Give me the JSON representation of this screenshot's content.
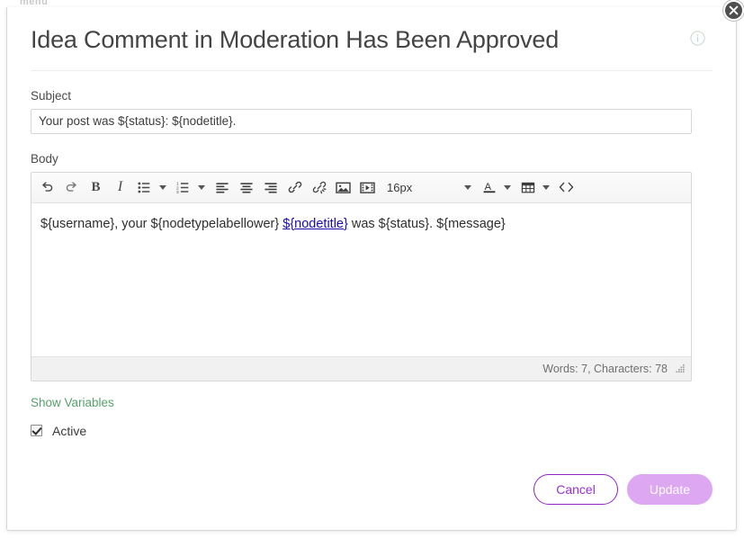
{
  "page_ghost": "menu",
  "dialog": {
    "title": "Idea Comment in Moderation Has Been Approved",
    "info_icon": "info-circle-icon",
    "close_icon": "close-icon"
  },
  "subject": {
    "label": "Subject",
    "value": "Your post was ${status}: ${nodetitle}.",
    "placeholder": ""
  },
  "body": {
    "label": "Body",
    "toolbar": {
      "items": [
        {
          "name": "undo-icon",
          "glyph": "undo",
          "label": ""
        },
        {
          "name": "redo-icon",
          "glyph": "redo",
          "label": ""
        },
        {
          "name": "bold-button",
          "glyph": "text",
          "label": "B"
        },
        {
          "name": "italic-button",
          "glyph": "text",
          "label": "I"
        },
        {
          "name": "unordered-list-icon",
          "glyph": "ul",
          "label": ""
        },
        {
          "name": "ordered-list-icon",
          "glyph": "ol",
          "label": ""
        },
        {
          "name": "align-left-icon",
          "glyph": "align-left",
          "label": ""
        },
        {
          "name": "align-center-icon",
          "glyph": "align-center",
          "label": ""
        },
        {
          "name": "align-right-icon",
          "glyph": "align-right",
          "label": ""
        },
        {
          "name": "link-icon",
          "glyph": "link",
          "label": ""
        },
        {
          "name": "unlink-icon",
          "glyph": "unlink",
          "label": ""
        },
        {
          "name": "image-icon",
          "glyph": "image",
          "label": ""
        },
        {
          "name": "video-icon",
          "glyph": "video",
          "label": ""
        }
      ],
      "font_size": "16px",
      "text_color_icon": "font-color-icon",
      "table_icon": "table-icon",
      "source_code_icon": "source-code-icon"
    },
    "content": {
      "before_link": "${username}, your ${nodetypelabellower} ",
      "link_text": "${nodetitle}",
      "after_link": " was ${status}. ${message}"
    },
    "status_text": "Words: 7, Characters: 78",
    "resize_grip_icon": "resize-grip-icon"
  },
  "show_variables_label": "Show Variables",
  "active": {
    "label": "Active",
    "checked": true
  },
  "footer": {
    "cancel_label": "Cancel",
    "update_label": "Update"
  },
  "colors": {
    "link_green": "#56a16b",
    "cancel_purple": "#8e24c4",
    "update_purple": "#dda7f2",
    "body_link_blue": "#1a0dab"
  }
}
